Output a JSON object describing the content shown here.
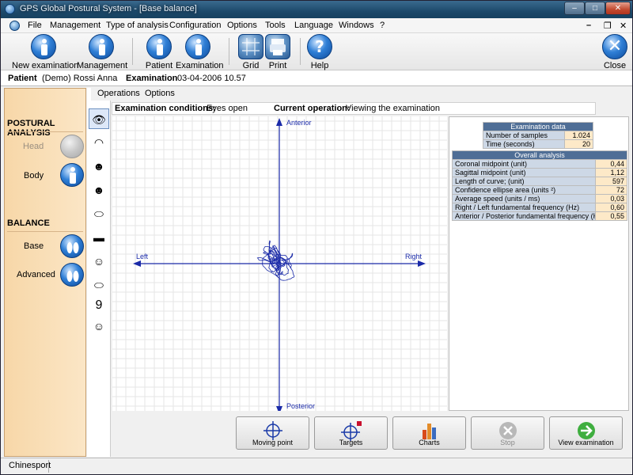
{
  "window": {
    "title": "GPS Global Postural System - [Base balance]"
  },
  "menu": [
    "File",
    "Management",
    "Type of analysis",
    "Configuration",
    "Options",
    "Tools",
    "Language",
    "Windows",
    "?"
  ],
  "toolbar": [
    {
      "label": "New examination",
      "icon": "person-icon"
    },
    {
      "label": "Management",
      "icon": "person-icon"
    },
    {
      "label": "Patient",
      "icon": "person-icon"
    },
    {
      "label": "Examination",
      "icon": "person-icon"
    },
    {
      "label": "Grid",
      "icon": "grid-icon"
    },
    {
      "label": "Print",
      "icon": "print-icon"
    },
    {
      "label": "Help",
      "icon": "help-icon"
    },
    {
      "label": "Close",
      "icon": "close-icon"
    }
  ],
  "patient_bar": {
    "patient_label": "Patient",
    "patient_value": "(Demo) Rossi Anna",
    "exam_label": "Examination",
    "exam_value": "03-04-2006 10.57"
  },
  "left_panel": {
    "postural_title": "POSTURAL ANALYSIS",
    "head": "Head",
    "body": "Body",
    "balance_title": "BALANCE",
    "base": "Base",
    "advanced": "Advanced"
  },
  "subtabs": [
    "Operations",
    "Options"
  ],
  "conditions": {
    "label": "Examination conditions:",
    "value": "Eyes open",
    "op_label": "Current operation:",
    "op_value": "Viewing the examination"
  },
  "plot_labels": {
    "anterior": "Anterior",
    "posterior": "Posterior",
    "left": "Left",
    "right": "Right"
  },
  "exam_data": {
    "title": "Examination data",
    "rows": [
      {
        "label": "Number of samples",
        "value": "1.024"
      },
      {
        "label": "Time (seconds)",
        "value": "20"
      }
    ]
  },
  "overall": {
    "title": "Overall analysis",
    "rows": [
      {
        "label": "Coronal midpoint (unit)",
        "value": "0,44"
      },
      {
        "label": "Sagittal midpoint (unit)",
        "value": "1,12"
      },
      {
        "label": "Length of curve; (unit)",
        "value": "597"
      },
      {
        "label": "Confidence ellipse area (units ²)",
        "value": "72"
      },
      {
        "label": "Average speed (units / ms)",
        "value": "0,03"
      },
      {
        "label": "Right / Left  fundamental frequency (Hz)",
        "value": "0,60"
      },
      {
        "label": "Anterior / Posterior fundamental frequency (H",
        "value": "0,55"
      }
    ]
  },
  "bottom_buttons": [
    {
      "label": "Moving point",
      "icon": "crosshair-icon",
      "enabled": true
    },
    {
      "label": "Targets",
      "icon": "target-icon",
      "enabled": true
    },
    {
      "label": "Charts",
      "icon": "bar-chart-icon",
      "enabled": true
    },
    {
      "label": "Stop",
      "icon": "stop-icon",
      "enabled": false
    },
    {
      "label": "View examination",
      "icon": "arrow-right-icon",
      "enabled": true
    }
  ],
  "status": {
    "text": "Chinesport"
  },
  "colors": {
    "accent": "#1f4faa",
    "trace": "#1a2aa8",
    "panel": "#f9dfb8",
    "table_header": "#4f6e96"
  }
}
